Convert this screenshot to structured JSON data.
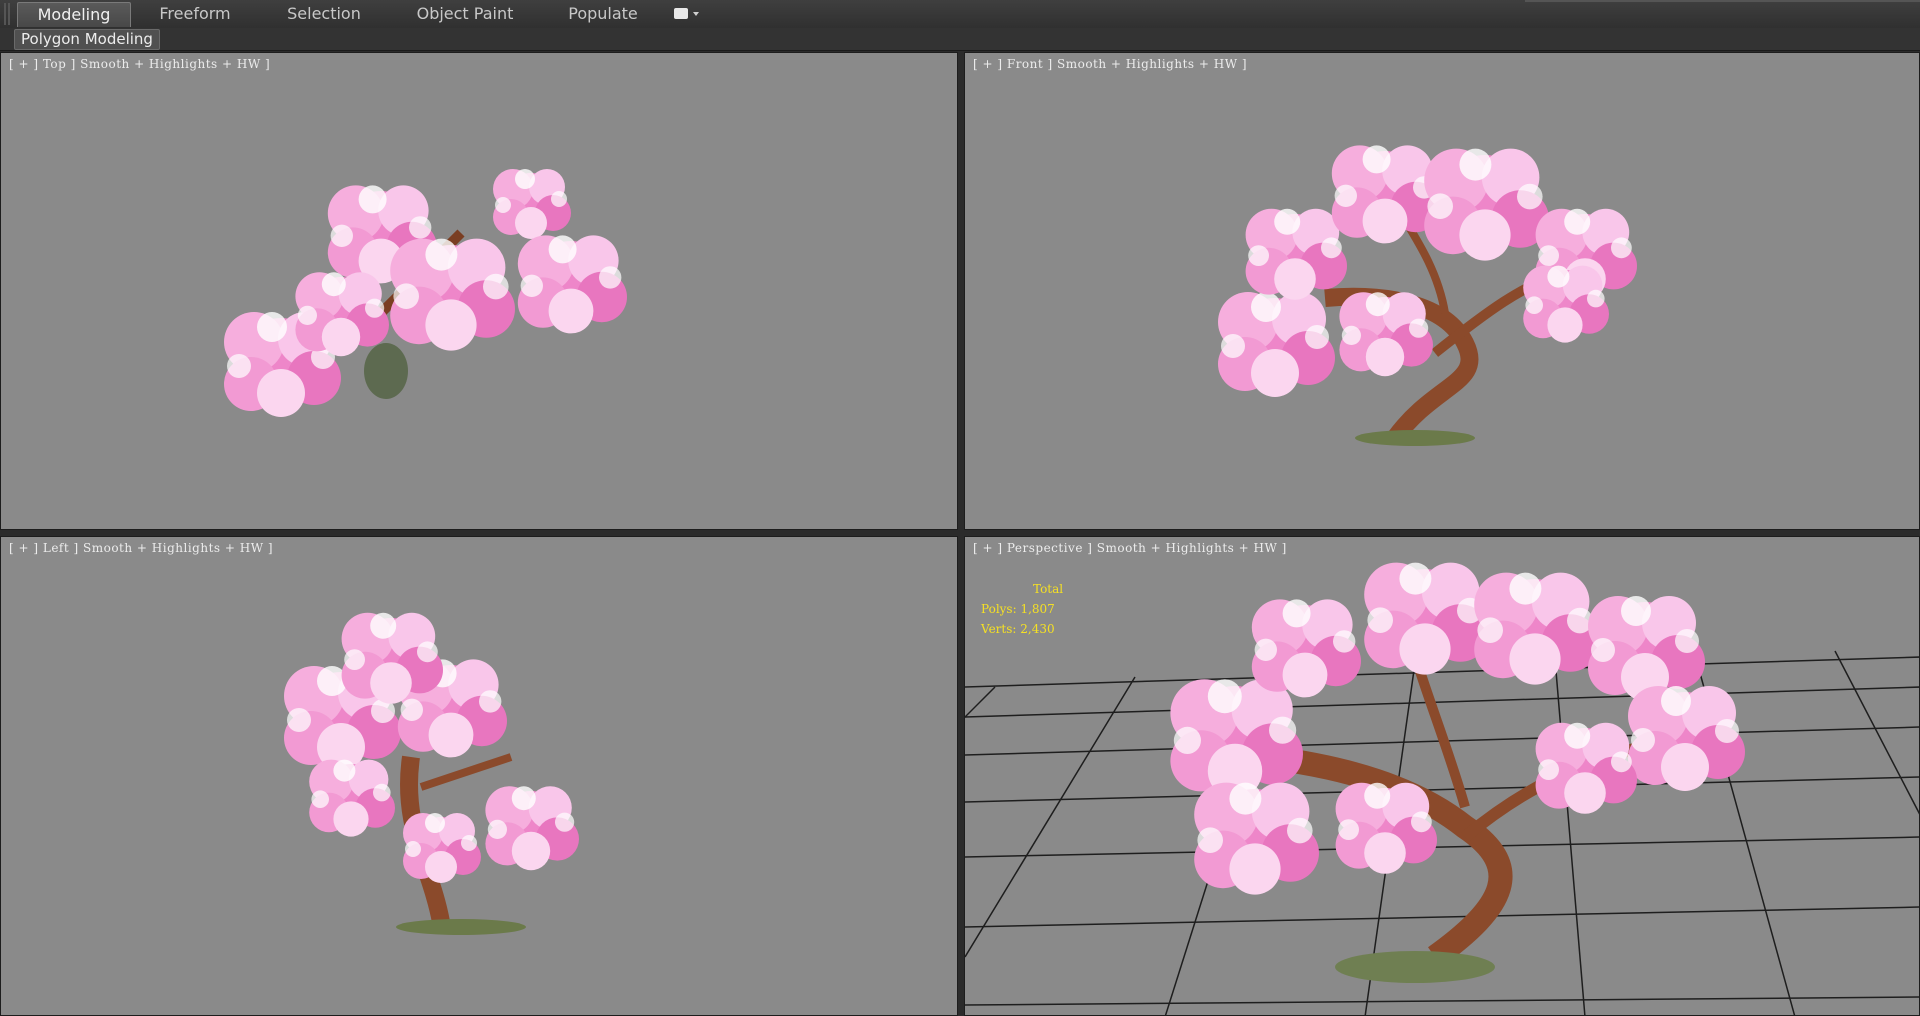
{
  "ribbon": {
    "tabs": [
      {
        "label": "Modeling",
        "active": true
      },
      {
        "label": "Freeform",
        "active": false
      },
      {
        "label": "Selection",
        "active": false
      },
      {
        "label": "Object Paint",
        "active": false
      },
      {
        "label": "Populate",
        "active": false
      }
    ],
    "panel_label": "Polygon Modeling"
  },
  "viewports": {
    "top": {
      "label": "[ + ] Top ] Smooth + Highlights + HW ]"
    },
    "front": {
      "label": "[ + ] Front ] Smooth + Highlights + HW ]"
    },
    "left": {
      "label": "[ + ] Left ] Smooth + Highlights + HW ]"
    },
    "perspective": {
      "label": "[ + ] Perspective ] Smooth + Highlights + HW ]"
    }
  },
  "stats": {
    "header": "Total",
    "polys": "Polys: 1,807",
    "verts": "Verts: 2,430"
  },
  "colors": {
    "viewport_bg": "#8a8a8a",
    "blossom": "#f08fcf",
    "blossom_light": "#fbd3ee",
    "trunk": "#8b4a2b",
    "stats_text": "#f5e024"
  }
}
